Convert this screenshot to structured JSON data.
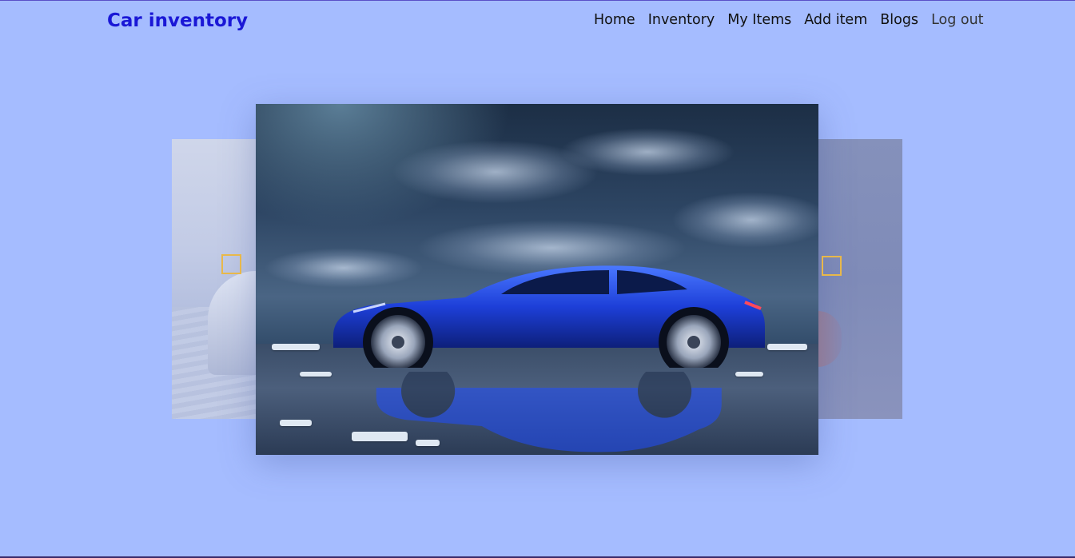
{
  "brand": {
    "title": "Car inventory"
  },
  "nav": {
    "items": [
      {
        "label": "Home"
      },
      {
        "label": "Inventory"
      },
      {
        "label": "My Items"
      },
      {
        "label": "Add item"
      },
      {
        "label": "Blogs"
      },
      {
        "label": "Log out"
      }
    ]
  },
  "carousel": {
    "prev_icon": "square-outline-icon",
    "next_icon": "square-outline-icon",
    "arrow_color": "#e8b84a"
  },
  "colors": {
    "background": "#a5bcff",
    "brand": "#1a17d6",
    "car": "#1d3fd8"
  }
}
